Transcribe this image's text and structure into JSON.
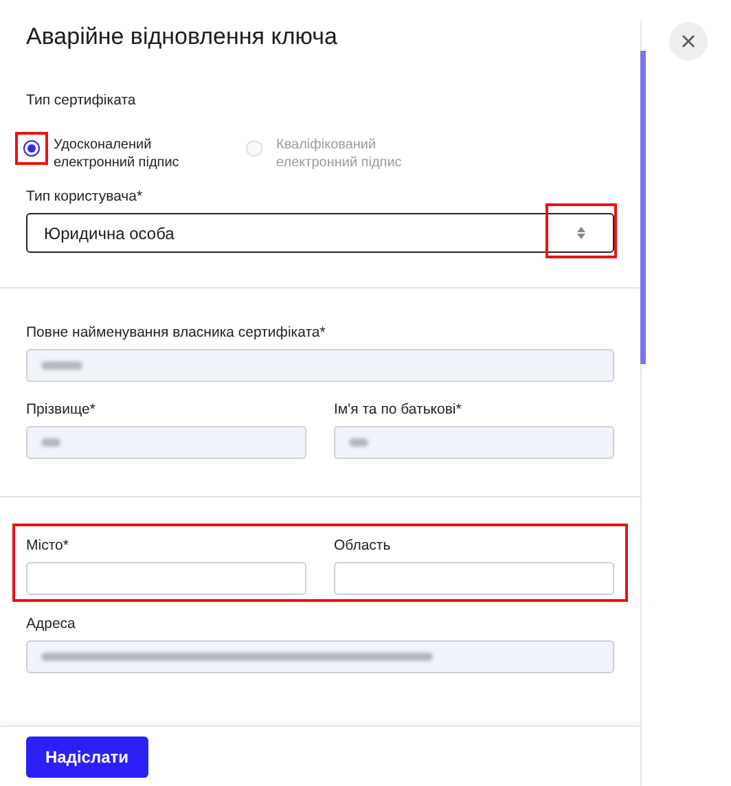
{
  "dialog": {
    "title": "Аварійне відновлення ключа"
  },
  "certificate_type": {
    "label": "Тип сертифіката",
    "options": [
      {
        "label": "Удосконалений електронний підпис",
        "selected": true,
        "disabled": false,
        "highlighted": true
      },
      {
        "label": "Кваліфікований електронний підпис",
        "selected": false,
        "disabled": true,
        "highlighted": false
      }
    ]
  },
  "user_type": {
    "label": "Тип користувача*",
    "value": "Юридична особа",
    "arrow_highlighted": true
  },
  "owner_section": {
    "rows": [
      {
        "fields": [
          {
            "label": "Повне найменування власника сертифіката*",
            "redacted": true
          }
        ]
      },
      {
        "fields": [
          {
            "label": "Прізвище*",
            "redacted": true
          },
          {
            "label": "Ім'я та по батькові*",
            "redacted": true
          }
        ]
      }
    ]
  },
  "address_section": {
    "highlighted": true,
    "fields": [
      {
        "label": "Місто*",
        "redacted": false
      },
      {
        "label": "Область",
        "redacted": false
      }
    ],
    "address": {
      "label": "Адреса",
      "redacted": true
    }
  },
  "footer": {
    "submit": "Надіслати"
  }
}
